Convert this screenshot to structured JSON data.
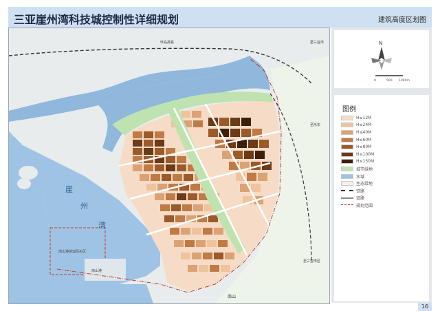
{
  "header": {
    "title": "三亚崖州湾科技城控制性详细规划",
    "subtitle": "建筑高度区划图"
  },
  "map": {
    "labels": {
      "bay_char_1": "崖",
      "bay_char_2": "州",
      "bay_char_3": "湾",
      "port_label": "南山港",
      "port_zone_label": "南山港货运码头区",
      "road_top": "环岛高铁",
      "road_east_1": "至乐东",
      "road_east_2": "至三亚市",
      "road_east_3": "至三亚市区",
      "south_label": "南山"
    },
    "colors": {
      "sea": "#9fc3e4",
      "river": "#8fb8dc",
      "land": "#e8ecec",
      "green": "#bfe3b0",
      "road": "#ffffff",
      "rail": "#333333",
      "boundary": "#c0392b"
    }
  },
  "compass": {
    "north": "N",
    "scale_start": "0",
    "scale_mid": "500",
    "scale_end": "1000m"
  },
  "legend": {
    "title": "图例",
    "items": [
      {
        "label": "H≤12M",
        "color": "#f6dcc6",
        "style": "fill"
      },
      {
        "label": "H≤24M",
        "color": "#efc39b",
        "style": "fill"
      },
      {
        "label": "H≤40M",
        "color": "#dba274",
        "style": "fill"
      },
      {
        "label": "H≤60M",
        "color": "#c07a45",
        "style": "fill"
      },
      {
        "label": "H≤80M",
        "color": "#9a5a2a",
        "style": "fill"
      },
      {
        "label": "H≤100M",
        "color": "#6b3a17",
        "style": "fill"
      },
      {
        "label": "H≤150M",
        "color": "#3d1f0b",
        "style": "fill"
      },
      {
        "label": "城市绿地",
        "color": "#bfe3b0",
        "style": "fill"
      },
      {
        "label": "水域",
        "color": "#9fc3e4",
        "style": "fill"
      },
      {
        "label": "生态绿地",
        "color": "#eef4ea",
        "style": "fill"
      },
      {
        "label": "铁路",
        "color": "#333333",
        "style": "dash"
      },
      {
        "label": "道路",
        "color": "#888888",
        "style": "line"
      },
      {
        "label": "规划范围",
        "color": "#c0392b",
        "style": "dashdot"
      }
    ]
  },
  "page_number": "16"
}
